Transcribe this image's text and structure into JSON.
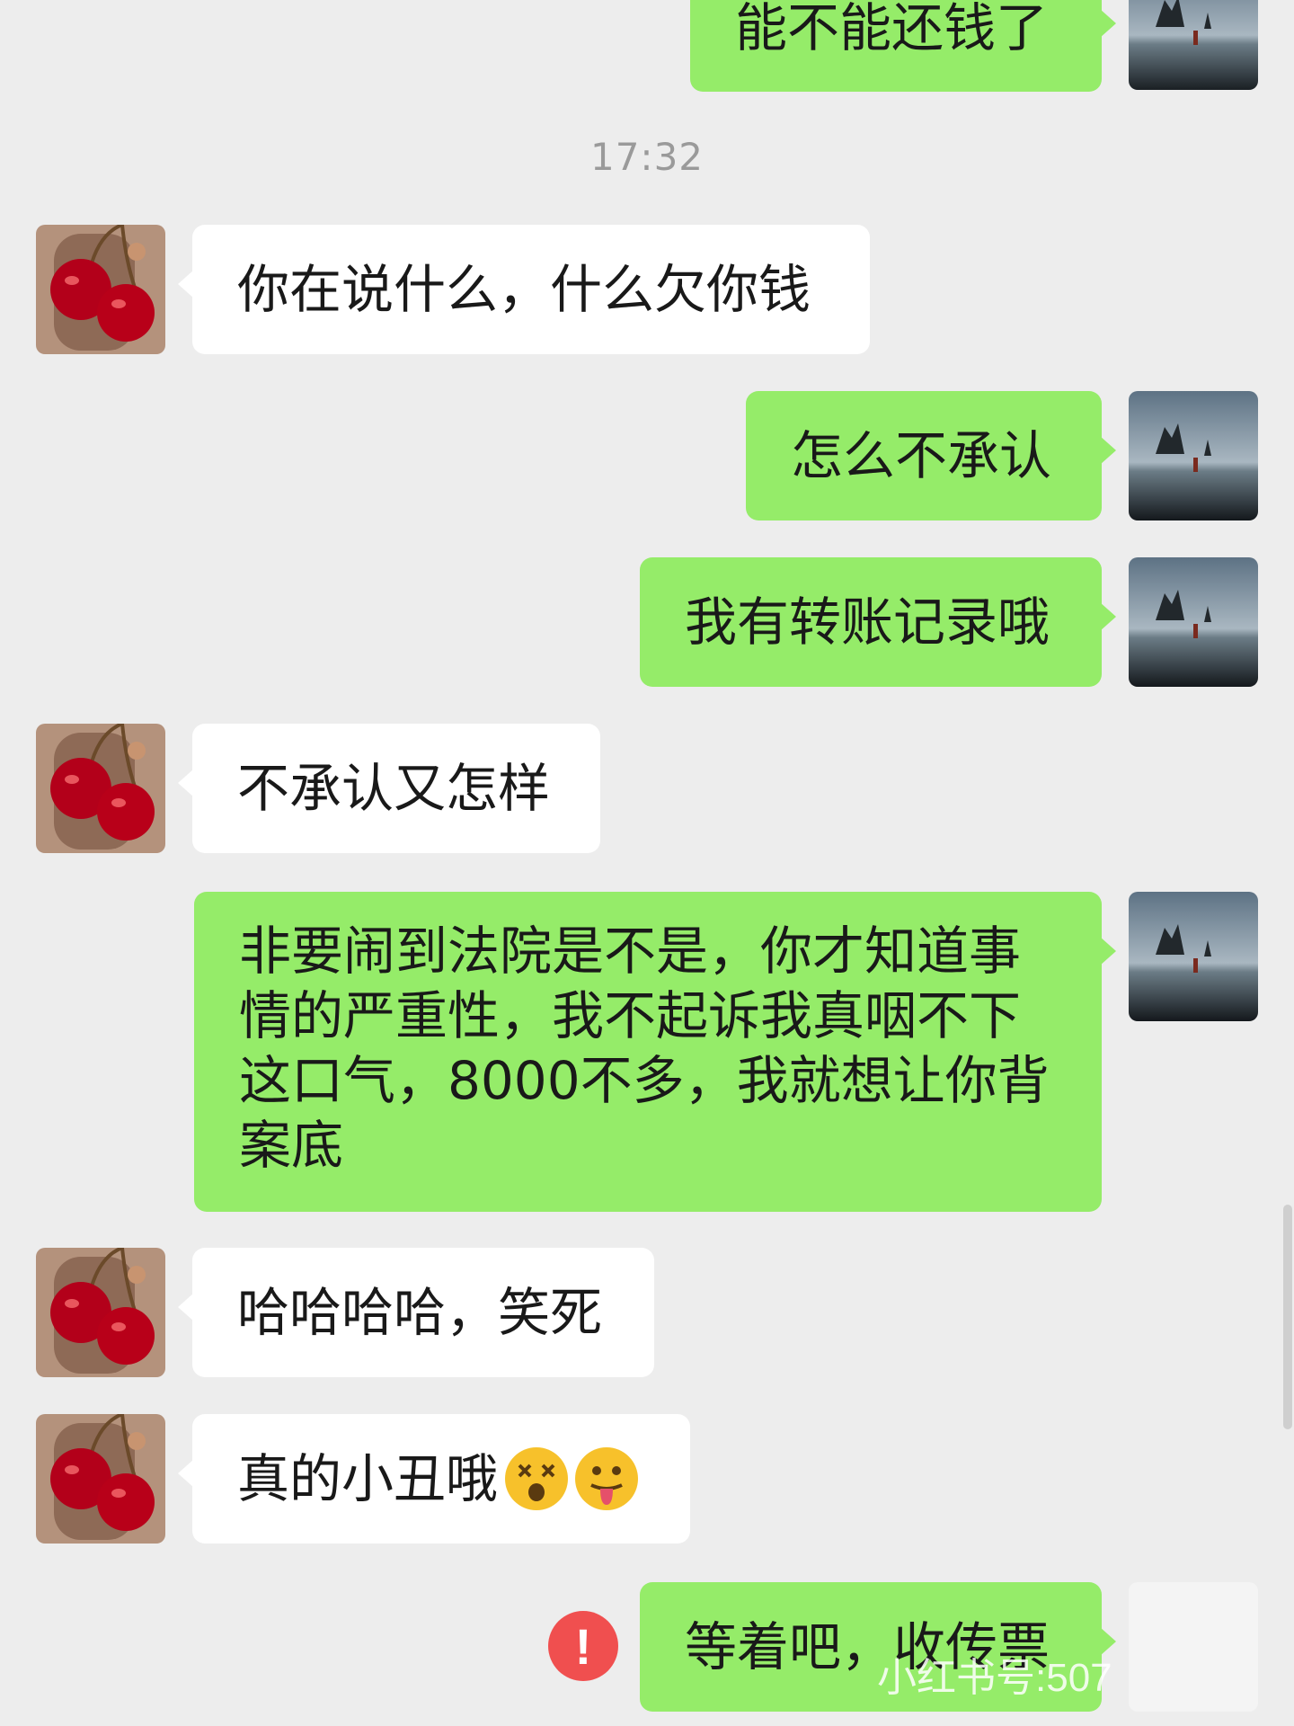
{
  "timestamp": "17:32",
  "messages": [
    {
      "text": "能不能还钱了"
    },
    {
      "text": "你在说什么，什么欠你钱"
    },
    {
      "text": "怎么不承认"
    },
    {
      "text": "我有转账记录哦"
    },
    {
      "text": "不承认又怎样"
    },
    {
      "lines": [
        "非要闹到法院是不是，你才知道事",
        "情的严重性，我不起诉我真咽不下",
        "这口气，8000不多，我就想让你背",
        "案底"
      ]
    },
    {
      "text": "哈哈哈哈，笑死"
    },
    {
      "text": "真的小丑哦"
    },
    {
      "text": "等着吧，收传票"
    }
  ],
  "emojis": [
    "dizzy-face-emoji",
    "tongue-out-emoji"
  ],
  "error_mark": "!",
  "watermark": "小红书号:507",
  "colors": {
    "background": "#ededed",
    "outgoing_bubble": "#95ec69",
    "incoming_bubble": "#ffffff",
    "error": "#f04f4f"
  }
}
